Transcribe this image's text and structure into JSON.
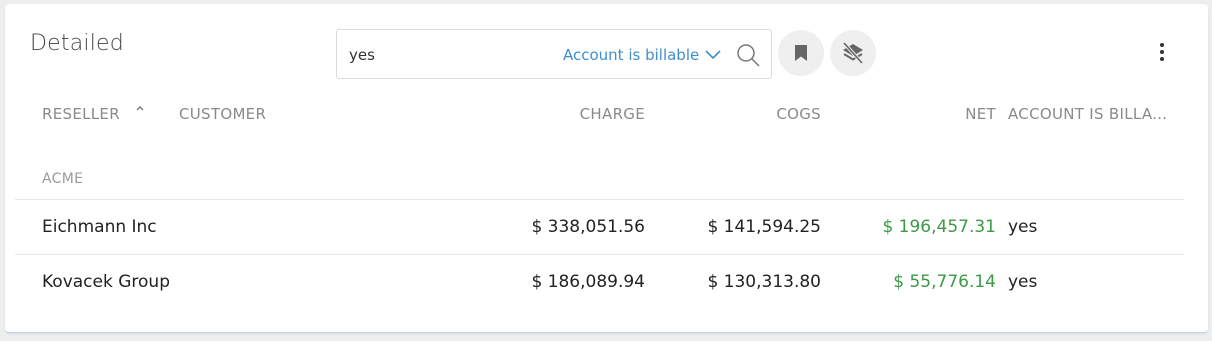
{
  "panel": {
    "title": "Detailed"
  },
  "search": {
    "value": "yes",
    "filter_label": "Account is billable"
  },
  "columns": {
    "reseller": "RESELLER",
    "customer": "CUSTOMER",
    "charge": "CHARGE",
    "cogs": "COGS",
    "net": "NET",
    "billable": "ACCOUNT IS BILLA..."
  },
  "group": {
    "label": "ACME"
  },
  "rows": [
    {
      "customer": "Eichmann Inc",
      "charge": "$ 338,051.56",
      "cogs": "$ 141,594.25",
      "net": "$ 196,457.31",
      "billable": "yes"
    },
    {
      "customer": "Kovacek Group",
      "charge": "$ 186,089.94",
      "cogs": "$ 130,313.80",
      "net": "$ 55,776.14",
      "billable": "yes"
    }
  ],
  "icons": {
    "search": "search-icon",
    "bookmark": "bookmark-icon",
    "layers_off": "layers-off-icon",
    "more": "more-vertical-icon",
    "filter_dropdown": "chevron-down-icon",
    "sort": "sort-asc-icon"
  },
  "colors": {
    "accent": "#3f8fcf",
    "net_positive": "#3c9a45",
    "header_text": "#8a8a8a"
  }
}
